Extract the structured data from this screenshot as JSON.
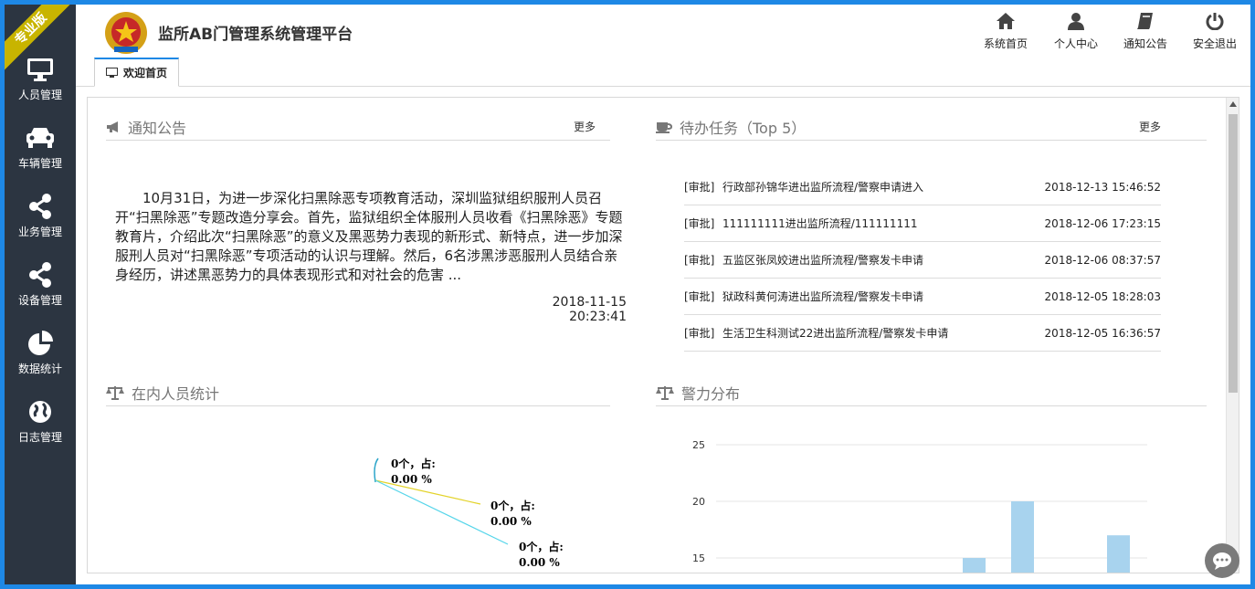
{
  "sidebar": {
    "badge": "专业版",
    "items": [
      {
        "label": "人员管理",
        "icon": "monitor-icon"
      },
      {
        "label": "车辆管理",
        "icon": "car-icon"
      },
      {
        "label": "业务管理",
        "icon": "share-icon"
      },
      {
        "label": "设备管理",
        "icon": "share-icon"
      },
      {
        "label": "数据统计",
        "icon": "pie-chart-icon"
      },
      {
        "label": "日志管理",
        "icon": "globe-icon"
      }
    ]
  },
  "header": {
    "title": "监所AB门管理系统管理平台",
    "tab_label": "欢迎首页",
    "actions": [
      {
        "label": "系统首页",
        "icon": "home-icon"
      },
      {
        "label": "个人中心",
        "icon": "user-icon"
      },
      {
        "label": "通知公告",
        "icon": "book-icon"
      },
      {
        "label": "安全退出",
        "icon": "power-icon"
      }
    ]
  },
  "notice": {
    "title": "通知公告",
    "more": "更多",
    "content": "10月31日，为进一步深化扫黑除恶专项教育活动，深圳监狱组织服刑人员召开“扫黑除恶”专题改造分享会。首先，监狱组织全体服刑人员收看《扫黑除恶》专题教育片，介绍此次“扫黑除恶”的意义及黑恶势力表现的新形式、新特点，进一步加深服刑人员对“扫黑除恶”专项活动的认识与理解。然后，6名涉黑涉恶服刑人员结合亲身经历，讲述黑恶势力的具体表现形式和对社会的危害 ...",
    "time": "2018-11-15 20:23:41"
  },
  "tasks": {
    "title": "待办任务（Top 5）",
    "more": "更多",
    "rows": [
      {
        "tag": "[审批]",
        "title": "行政部孙锦华进出监所流程/警察申请进入",
        "time": "2018-12-13 15:46:52"
      },
      {
        "tag": "[审批]",
        "title": "111111111进出监所流程/111111111",
        "time": "2018-12-06 17:23:15"
      },
      {
        "tag": "[审批]",
        "title": "五监区张凤姣进出监所流程/警察发卡申请",
        "time": "2018-12-06 08:37:57"
      },
      {
        "tag": "[审批]",
        "title": "狱政科黄何涛进出监所流程/警察发卡申请",
        "time": "2018-12-05 18:28:03"
      },
      {
        "tag": "[审批]",
        "title": "生活卫生科测试22进出监所流程/警察发卡申请",
        "time": "2018-12-05 16:36:57"
      }
    ]
  },
  "stats": {
    "title": "在内人员统计",
    "labels": [
      {
        "line1": "0个，占:",
        "line2": "0.00 %"
      },
      {
        "line1": "0个，占:",
        "line2": "0.00 %"
      },
      {
        "line1": "0个，占:",
        "line2": "0.00 %"
      }
    ]
  },
  "police": {
    "title": "警力分布"
  },
  "chart_data": {
    "type": "bar",
    "y_ticks": [
      "25",
      "20",
      "15"
    ],
    "ylim_visible": [
      15,
      25
    ],
    "values": [
      15,
      20,
      17,
      15
    ],
    "bar_color": "#a8d3ee",
    "grid": true
  },
  "colors": {
    "sidebar": "#2c3541",
    "frame": "#1e88e5",
    "ribbon": "#c8b400",
    "bar": "#a8d3ee"
  }
}
